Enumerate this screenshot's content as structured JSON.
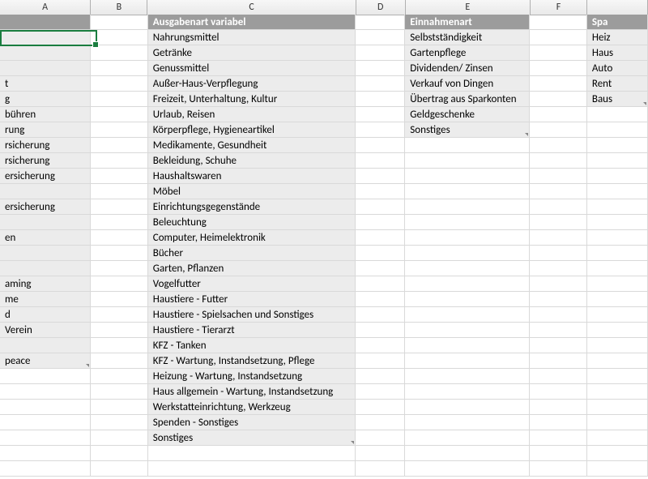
{
  "columns": {
    "A": "A",
    "B": "B",
    "C": "C",
    "D": "D",
    "E": "E",
    "F": "F"
  },
  "headers": {
    "C": "Ausgabenart variabel",
    "E": "Einnahmenart",
    "G": "Spa"
  },
  "colA": {
    "r4": "t",
    "r5": "g",
    "r6": "bühren",
    "r7": "rung",
    "r8": "rsicherung",
    "r9": "rsicherung",
    "r10": "ersicherung",
    "r12": "ersicherung",
    "r14": "en",
    "r17": "aming",
    "r18": "me",
    "r19": "d",
    "r20": "Verein",
    "r22": "peace"
  },
  "colC": {
    "r1": "Nahrungsmittel",
    "r2": "Getränke",
    "r3": "Genussmittel",
    "r4": "Außer-Haus-Verpflegung",
    "r5": "Freizeit, Unterhaltung, Kultur",
    "r6": "Urlaub, Reisen",
    "r7": "Körperpflege, Hygieneartikel",
    "r8": "Medikamente, Gesundheit",
    "r9": "Bekleidung, Schuhe",
    "r10": "Haushaltswaren",
    "r11": "Möbel",
    "r12": "Einrichtungsgegenstände",
    "r13": "Beleuchtung",
    "r14": "Computer, Heimelektronik",
    "r15": "Bücher",
    "r16": "Garten, Pflanzen",
    "r17": "Vogelfutter",
    "r18": "Haustiere - Futter",
    "r19": "Haustiere - Spielsachen und Sonstiges",
    "r20": "Haustiere - Tierarzt",
    "r21": "KFZ - Tanken",
    "r22": "KFZ - Wartung, Instandsetzung, Pflege",
    "r23": "Heizung - Wartung, Instandsetzung",
    "r24": "Haus allgemein - Wartung, Instandsetzung",
    "r25": "Werkstatteinrichtung, Werkzeug",
    "r26": "Spenden - Sonstiges",
    "r27": "Sonstiges"
  },
  "colE": {
    "r1": "Selbstständigkeit",
    "r2": "Gartenpflege",
    "r3": "Dividenden/ Zinsen",
    "r4": "Verkauf von Dingen",
    "r5": "Übertrag aus Sparkonten",
    "r6": "Geldgeschenke",
    "r7": "Sonstiges"
  },
  "colG": {
    "r1": "Heiz",
    "r2": "Haus",
    "r3": "Auto",
    "r4": "Rent",
    "r5": "Baus"
  }
}
